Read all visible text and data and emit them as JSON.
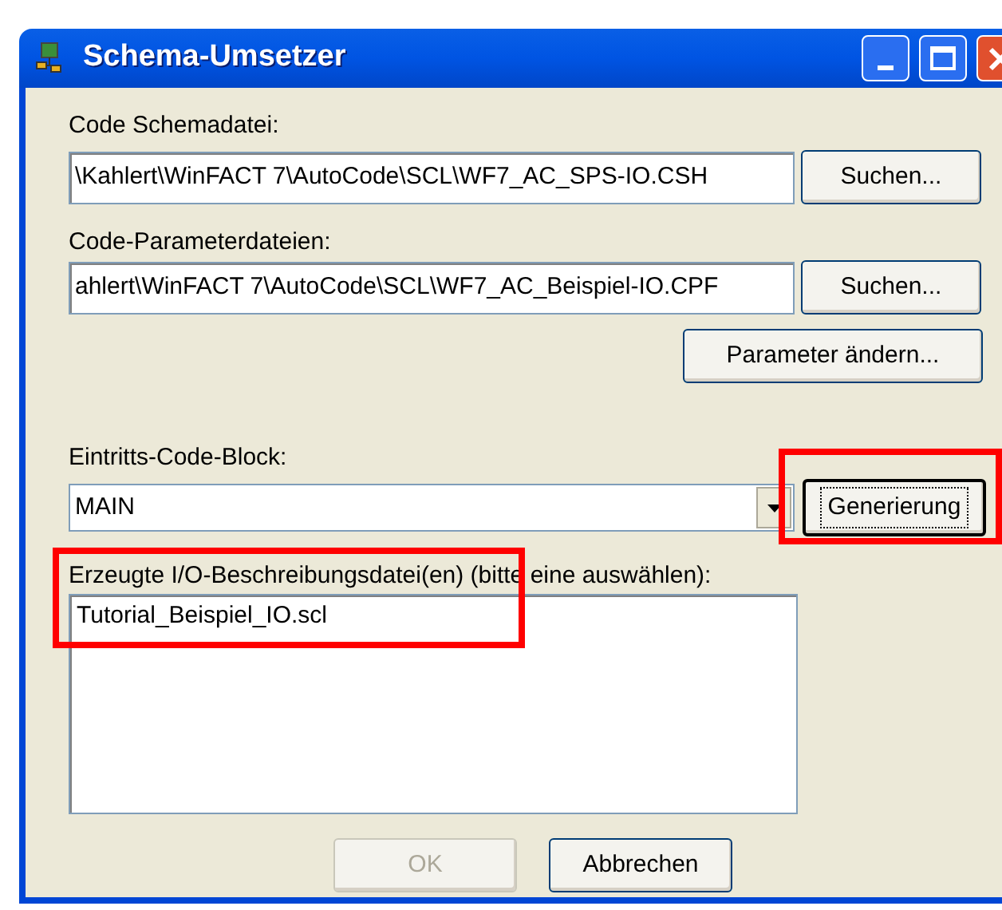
{
  "window": {
    "title": "Schema-Umsetzer"
  },
  "schema_file": {
    "label": "Code Schemadatei:",
    "value": "\\Kahlert\\WinFACT 7\\AutoCode\\SCL\\WF7_AC_SPS-IO.CSH",
    "button": "Suchen..."
  },
  "parameter_files": {
    "label": "Code-Parameterdateien:",
    "value": "ahlert\\WinFACT 7\\AutoCode\\SCL\\WF7_AC_Beispiel-IO.CPF",
    "button": "Suchen...",
    "edit_button": "Parameter ändern..."
  },
  "entry_block": {
    "label": "Eintritts-Code-Block:",
    "value": "MAIN",
    "button": {
      "label": "Generierung",
      "focused": true
    }
  },
  "output_files": {
    "label": "Erzeugte I/O-Beschreibungsdatei(en) (bitte eine auswählen):",
    "items": [
      {
        "label": "Tutorial_Beispiel_IO.scl",
        "selected": false
      }
    ]
  },
  "buttons": [
    {
      "label": "OK",
      "disabled": true
    },
    {
      "label": "Abbrechen",
      "disabled": false
    }
  ]
}
